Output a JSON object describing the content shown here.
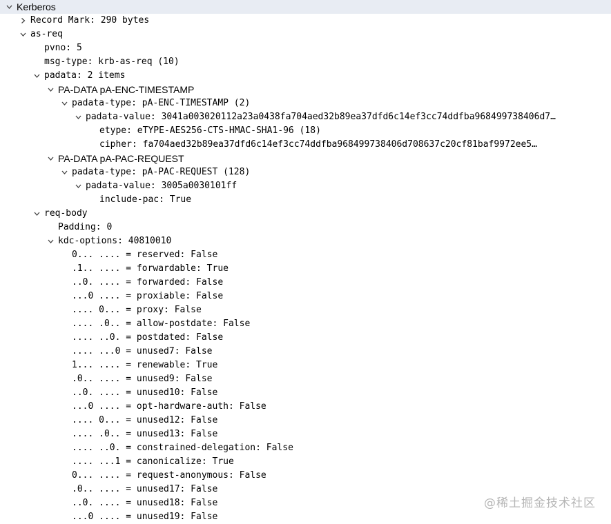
{
  "tree": [
    {
      "level": 0,
      "toggle": "open",
      "text": "Kerberos",
      "selected": true,
      "prop": true
    },
    {
      "level": 1,
      "toggle": "closed",
      "text": "Record Mark: 290 bytes"
    },
    {
      "level": 1,
      "toggle": "open",
      "text": "as-req"
    },
    {
      "level": 2,
      "toggle": "none",
      "text": "pvno: 5"
    },
    {
      "level": 2,
      "toggle": "none",
      "text": "msg-type: krb-as-req (10)"
    },
    {
      "level": 2,
      "toggle": "open",
      "text": "padata: 2 items"
    },
    {
      "level": 3,
      "toggle": "open",
      "text": "PA-DATA pA-ENC-TIMESTAMP",
      "prop": true
    },
    {
      "level": 4,
      "toggle": "open",
      "text": "padata-type: pA-ENC-TIMESTAMP (2)"
    },
    {
      "level": 5,
      "toggle": "open",
      "text": "padata-value: 3041a003020112a23a0438fa704aed32b89ea37dfd6c14ef3cc74ddfba968499738406d7…"
    },
    {
      "level": 6,
      "toggle": "none",
      "text": "etype: eTYPE-AES256-CTS-HMAC-SHA1-96 (18)"
    },
    {
      "level": 6,
      "toggle": "none",
      "text": "cipher: fa704aed32b89ea37dfd6c14ef3cc74ddfba968499738406d708637c20cf81baf9972ee5…"
    },
    {
      "level": 3,
      "toggle": "open",
      "text": "PA-DATA pA-PAC-REQUEST",
      "prop": true
    },
    {
      "level": 4,
      "toggle": "open",
      "text": "padata-type: pA-PAC-REQUEST (128)"
    },
    {
      "level": 5,
      "toggle": "open",
      "text": "padata-value: 3005a0030101ff"
    },
    {
      "level": 6,
      "toggle": "none",
      "text": "include-pac: True"
    },
    {
      "level": 2,
      "toggle": "open",
      "text": "req-body"
    },
    {
      "level": 3,
      "toggle": "none",
      "text": "Padding: 0"
    },
    {
      "level": 3,
      "toggle": "open",
      "text": "kdc-options: 40810010"
    },
    {
      "level": 4,
      "toggle": "none",
      "text": "0... .... = reserved: False"
    },
    {
      "level": 4,
      "toggle": "none",
      "text": ".1.. .... = forwardable: True"
    },
    {
      "level": 4,
      "toggle": "none",
      "text": "..0. .... = forwarded: False"
    },
    {
      "level": 4,
      "toggle": "none",
      "text": "...0 .... = proxiable: False"
    },
    {
      "level": 4,
      "toggle": "none",
      "text": ".... 0... = proxy: False"
    },
    {
      "level": 4,
      "toggle": "none",
      "text": ".... .0.. = allow-postdate: False"
    },
    {
      "level": 4,
      "toggle": "none",
      "text": ".... ..0. = postdated: False"
    },
    {
      "level": 4,
      "toggle": "none",
      "text": ".... ...0 = unused7: False"
    },
    {
      "level": 4,
      "toggle": "none",
      "text": "1... .... = renewable: True"
    },
    {
      "level": 4,
      "toggle": "none",
      "text": ".0.. .... = unused9: False"
    },
    {
      "level": 4,
      "toggle": "none",
      "text": "..0. .... = unused10: False"
    },
    {
      "level": 4,
      "toggle": "none",
      "text": "...0 .... = opt-hardware-auth: False"
    },
    {
      "level": 4,
      "toggle": "none",
      "text": ".... 0... = unused12: False"
    },
    {
      "level": 4,
      "toggle": "none",
      "text": ".... .0.. = unused13: False"
    },
    {
      "level": 4,
      "toggle": "none",
      "text": ".... ..0. = constrained-delegation: False"
    },
    {
      "level": 4,
      "toggle": "none",
      "text": ".... ...1 = canonicalize: True"
    },
    {
      "level": 4,
      "toggle": "none",
      "text": "0... .... = request-anonymous: False"
    },
    {
      "level": 4,
      "toggle": "none",
      "text": ".0.. .... = unused17: False"
    },
    {
      "level": 4,
      "toggle": "none",
      "text": "..0. .... = unused18: False"
    },
    {
      "level": 4,
      "toggle": "none",
      "text": "...0 .... = unused19: False"
    }
  ],
  "watermark": "@稀土掘金技术社区",
  "colors": {
    "selected_row": "#e8ecf3",
    "toggle": "#444444",
    "watermark": "#b6b6b6"
  }
}
